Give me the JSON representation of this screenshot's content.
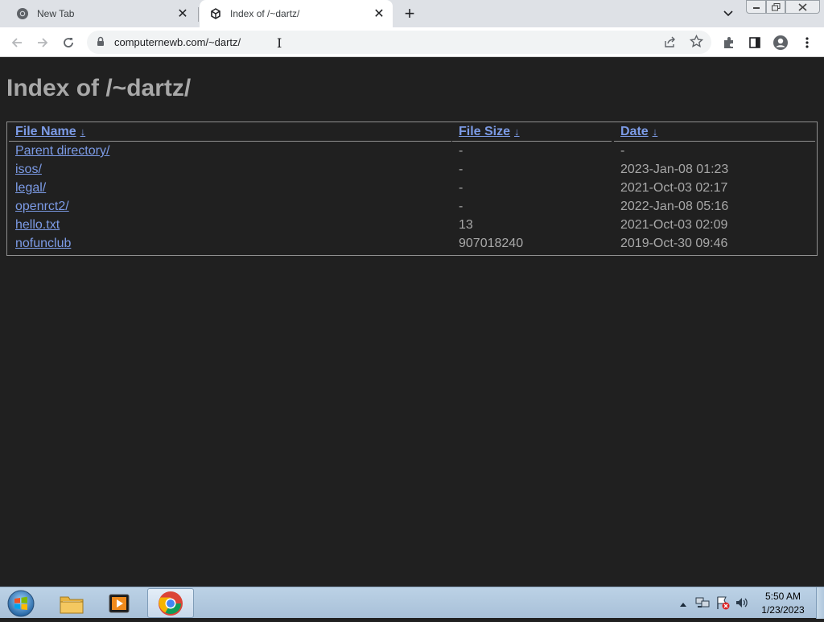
{
  "browser": {
    "tabs": [
      {
        "title": "New Tab",
        "active": false
      },
      {
        "title": "Index of /~dartz/",
        "active": true
      }
    ],
    "url": "computernewb.com/~dartz/"
  },
  "page": {
    "title": "Index of /~dartz/",
    "columns": {
      "name": "File Name",
      "size": "File Size",
      "date": "Date",
      "sort_indicator": "↓"
    },
    "rows": [
      {
        "name": "Parent directory/",
        "size": "-",
        "date": "-"
      },
      {
        "name": "isos/",
        "size": "-",
        "date": "2023-Jan-08 01:23"
      },
      {
        "name": "legal/",
        "size": "-",
        "date": "2021-Oct-03 02:17"
      },
      {
        "name": "openrct2/",
        "size": "-",
        "date": "2022-Jan-08 05:16"
      },
      {
        "name": "hello.txt",
        "size": "13",
        "date": "2021-Oct-03 02:09"
      },
      {
        "name": "nofunclub",
        "size": "907018240",
        "date": "2019-Oct-30 09:46"
      }
    ]
  },
  "taskbar": {
    "time": "5:50 AM",
    "date": "1/23/2023"
  },
  "colors": {
    "page_bg": "#202020",
    "link": "#7c9be6",
    "text": "#a8a8a8"
  }
}
